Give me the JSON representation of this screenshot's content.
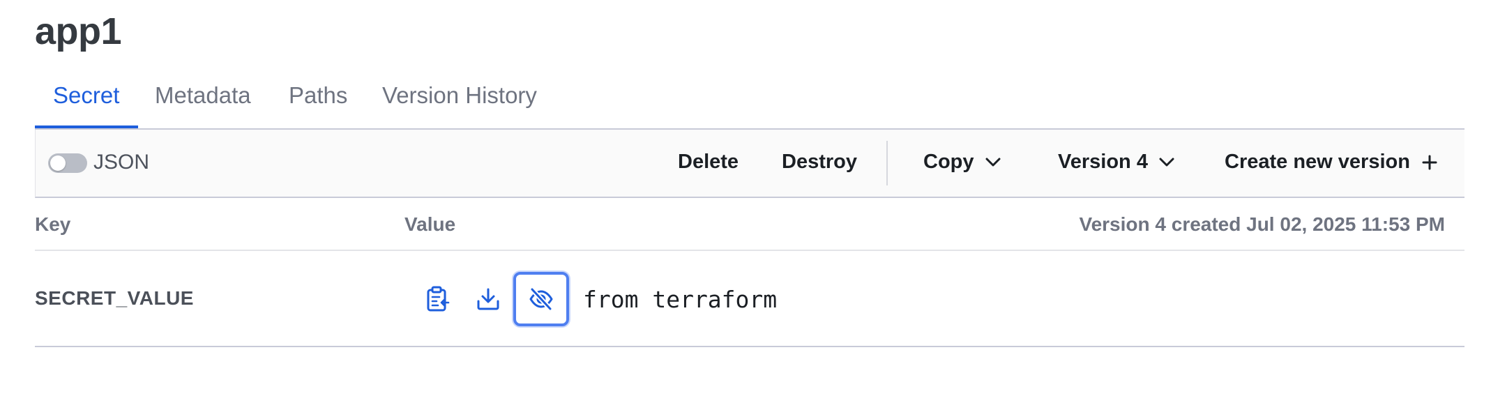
{
  "page": {
    "title": "app1"
  },
  "tabs": [
    {
      "label": "Secret",
      "active": true
    },
    {
      "label": "Metadata",
      "active": false
    },
    {
      "label": "Paths",
      "active": false
    },
    {
      "label": "Version History",
      "active": false
    }
  ],
  "toolbar": {
    "json_toggle_label": "JSON",
    "json_toggle_on": false,
    "delete_label": "Delete",
    "destroy_label": "Destroy",
    "copy_label": "Copy",
    "version_label": "Version 4",
    "create_label": "Create new version"
  },
  "table": {
    "key_header": "Key",
    "value_header": "Value",
    "version_info": "Version 4 created Jul 02, 2025 11:53 PM",
    "rows": [
      {
        "key": "SECRET_VALUE",
        "value": "from terraform"
      }
    ]
  },
  "icons": {
    "copy_row": "clipboard-copy-icon",
    "download_row": "download-icon",
    "reveal_row": "eye-off-icon",
    "dropdown": "chevron-down-icon",
    "add": "plus-icon"
  },
  "colors": {
    "accent": "#1e5edc",
    "focus_ring": "#4f7ff0"
  }
}
